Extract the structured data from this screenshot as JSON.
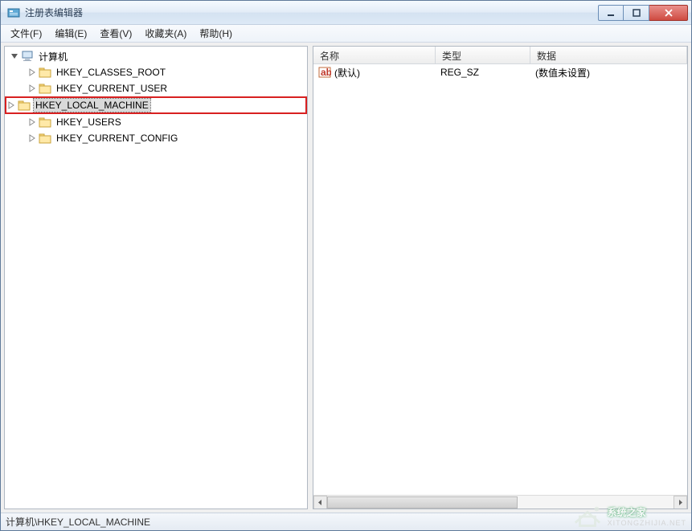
{
  "window": {
    "title": "注册表编辑器"
  },
  "menus": {
    "file": "文件(F)",
    "edit": "编辑(E)",
    "view": "查看(V)",
    "favorites": "收藏夹(A)",
    "help": "帮助(H)"
  },
  "tree": {
    "root": {
      "label": "计算机",
      "expanded": true
    },
    "children": [
      {
        "key": "hkcr",
        "label": "HKEY_CLASSES_ROOT",
        "selected": false,
        "highlighted": false
      },
      {
        "key": "hkcu",
        "label": "HKEY_CURRENT_USER",
        "selected": false,
        "highlighted": false
      },
      {
        "key": "hklm",
        "label": "HKEY_LOCAL_MACHINE",
        "selected": true,
        "highlighted": true
      },
      {
        "key": "hku",
        "label": "HKEY_USERS",
        "selected": false,
        "highlighted": false
      },
      {
        "key": "hkcc",
        "label": "HKEY_CURRENT_CONFIG",
        "selected": false,
        "highlighted": false
      }
    ]
  },
  "list": {
    "columns": {
      "name": "名称",
      "type": "类型",
      "data": "数据"
    },
    "rows": [
      {
        "name": "(默认)",
        "type": "REG_SZ",
        "data": "(数值未设置)",
        "icon": "string-value-icon"
      }
    ]
  },
  "statusbar": {
    "path": "计算机\\HKEY_LOCAL_MACHINE"
  },
  "watermark": {
    "brand": "系统之家",
    "sub": "XITONGZHIJIA.NET"
  }
}
